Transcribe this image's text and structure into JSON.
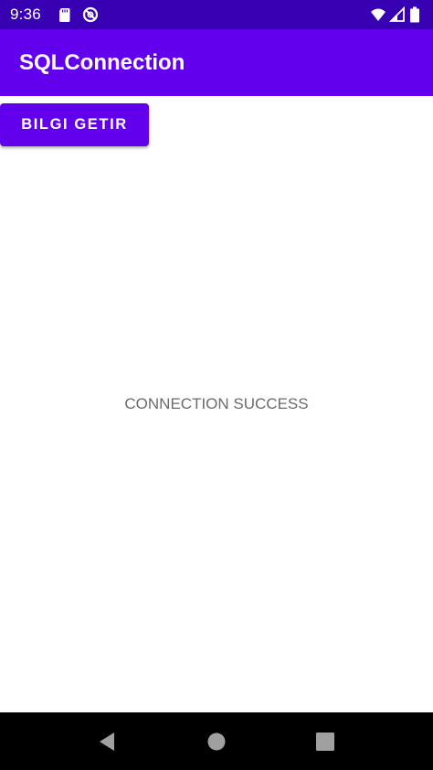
{
  "status_bar": {
    "time": "9:36",
    "icons": [
      "sd-card-icon",
      "data-saver-icon",
      "wifi-icon",
      "signal-icon",
      "battery-icon"
    ],
    "color": "#3700b3"
  },
  "app_bar": {
    "title": "SQLConnection",
    "color": "#6200ee"
  },
  "main": {
    "fetch_button_label": "BILGI GETIR",
    "connection_status": "CONNECTION SUCCESS"
  },
  "nav_bar": {
    "buttons": [
      "back-icon",
      "home-icon",
      "recents-icon"
    ]
  }
}
